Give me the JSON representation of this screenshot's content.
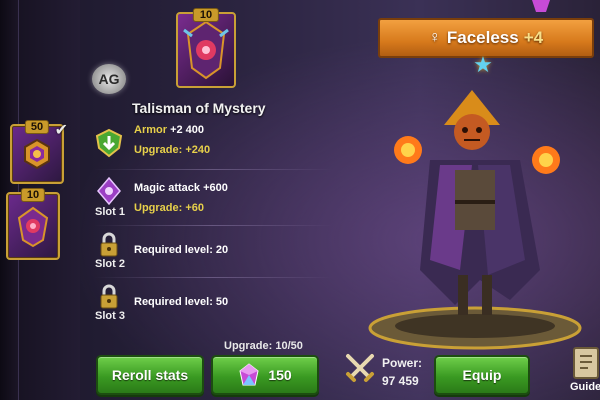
{
  "top_item": {
    "level": "10"
  },
  "logo": {
    "text": "AG"
  },
  "item": {
    "title": "Talisman of Mystery",
    "rows": [
      {
        "slot": "",
        "main_prefix": "Armor",
        "main_value": " +2 400",
        "upgrade_label": "Upgrade: ",
        "upgrade_value": "+240",
        "icon": "shield-arrow-icon"
      },
      {
        "slot": "Slot 1",
        "main_prefix": "Magic attack",
        "main_value": " +600",
        "upgrade_label": "Upgrade: ",
        "upgrade_value": "+60",
        "icon": "magic-crystal-icon"
      },
      {
        "slot": "Slot 2",
        "main_prefix": "Required level: ",
        "main_value": "20",
        "icon": "lock-icon"
      },
      {
        "slot": "Slot 3",
        "main_prefix": "Required level: ",
        "main_value": "50",
        "icon": "lock-icon"
      }
    ],
    "upgrade_progress": "Upgrade: 10/50"
  },
  "buttons": {
    "reroll": "Reroll stats",
    "cost": "150",
    "equip": "Equip"
  },
  "left_items": [
    {
      "level": "50",
      "checked": true
    },
    {
      "level": "10",
      "checked": false
    }
  ],
  "hero": {
    "name": "Faceless",
    "bonus": "+4",
    "gender_symbol": "♀",
    "power_label": "Power:",
    "power_value": "97 459"
  },
  "guide": {
    "label": "Guide"
  },
  "colors": {
    "gold": "#c9a036",
    "button_green": "#3a9a22",
    "highlight_yellow": "#e7d04a",
    "banner_orange": "#d77a1c"
  }
}
